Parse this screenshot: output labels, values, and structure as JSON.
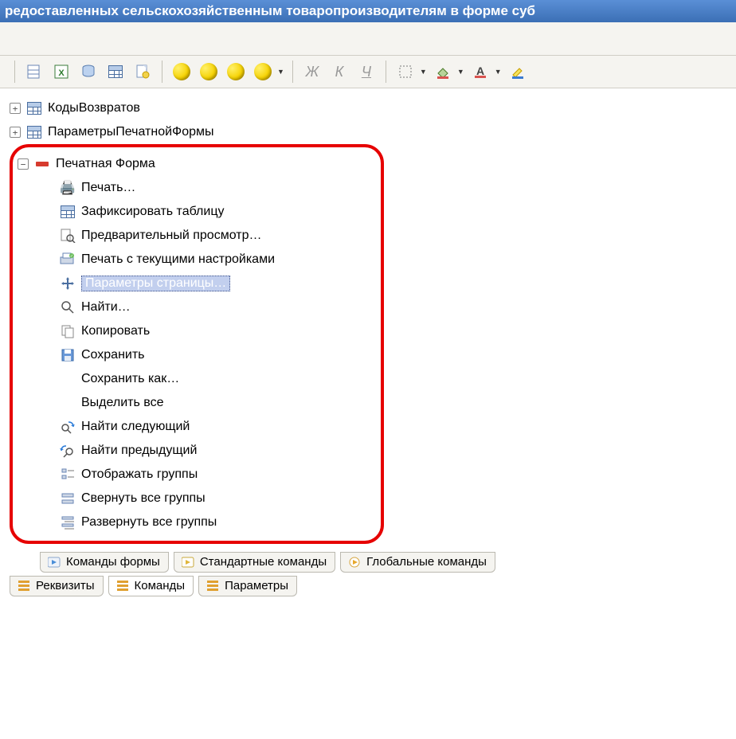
{
  "title": "редоставленных сельскохозяйственным товаропроизводителям в форме суб",
  "tree": {
    "top": [
      {
        "label": "КодыВозвратов"
      },
      {
        "label": "ПараметрыПечатнойФормы"
      }
    ],
    "group": {
      "label": "Печатная Форма",
      "children": [
        {
          "label": "Печать…",
          "icon": "printer"
        },
        {
          "label": "Зафиксировать таблицу",
          "icon": "table"
        },
        {
          "label": "Предварительный просмотр…",
          "icon": "preview"
        },
        {
          "label": "Печать с текущими настройками",
          "icon": "print-set"
        },
        {
          "label": "Параметры страницы…",
          "icon": "move",
          "selected": true
        },
        {
          "label": "Найти…",
          "icon": "search"
        },
        {
          "label": "Копировать",
          "icon": "copy"
        },
        {
          "label": "Сохранить",
          "icon": "save"
        },
        {
          "label": "Сохранить как…",
          "icon": ""
        },
        {
          "label": "Выделить все",
          "icon": ""
        },
        {
          "label": "Найти следующий",
          "icon": "search-next"
        },
        {
          "label": "Найти предыдущий",
          "icon": "search-prev"
        },
        {
          "label": "Отображать группы",
          "icon": "groups"
        },
        {
          "label": "Свернуть все группы",
          "icon": "collapse"
        },
        {
          "label": "Развернуть все группы",
          "icon": "expand"
        }
      ]
    }
  },
  "tabs_upper": [
    {
      "label": "Команды формы"
    },
    {
      "label": "Стандартные команды"
    },
    {
      "label": "Глобальные команды"
    }
  ],
  "tabs_lower": [
    {
      "label": "Реквизиты"
    },
    {
      "label": "Команды"
    },
    {
      "label": "Параметры"
    }
  ],
  "toolbar_text": {
    "zh": "Ж",
    "k": "К",
    "ch": "Ч"
  }
}
